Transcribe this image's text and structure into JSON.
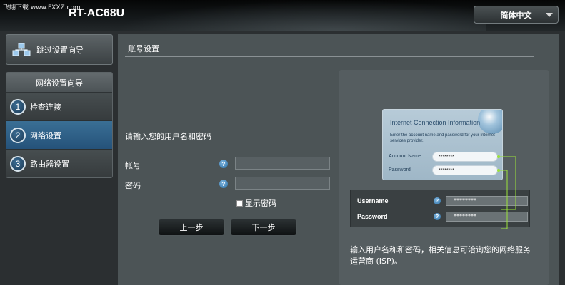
{
  "header": {
    "watermark": "飞翔下载 www.FXXZ.com",
    "model": "RT-AC68U",
    "language": "简体中文"
  },
  "sidebar": {
    "skip_label": "跳过设置向导",
    "wizard_title": "网络设置向导",
    "steps": [
      {
        "num": "1",
        "label": "检查连接",
        "active": false
      },
      {
        "num": "2",
        "label": "网络设置",
        "active": true
      },
      {
        "num": "3",
        "label": "路由器设置",
        "active": false
      }
    ]
  },
  "main": {
    "title": "账号设置",
    "prompt": "请输入您的用户名和密码",
    "account_label": "帐号",
    "password_label": "密码",
    "account_value": "",
    "password_value": "",
    "show_password_label": "显示密码",
    "prev_label": "上一步",
    "next_label": "下一步",
    "help_glyph": "?"
  },
  "illustration": {
    "card_title": "Internet Connection Information",
    "card_desc": "Enter the account name and password for your Internet services provider.",
    "card_account_label": "Account Name",
    "card_password_label": "Password",
    "card_account_value": "********",
    "card_password_value": "********",
    "router_username_label": "Username",
    "router_password_label": "Password",
    "router_username_value": "********",
    "router_password_value": "********",
    "note": "输入用户名称和密码，相关信息可洽询您的网络服务运营商 (ISP)。",
    "connector_color": "#9be23a"
  },
  "colors": {
    "active_step": "#2f6289",
    "help_icon": "#3a80b8"
  }
}
